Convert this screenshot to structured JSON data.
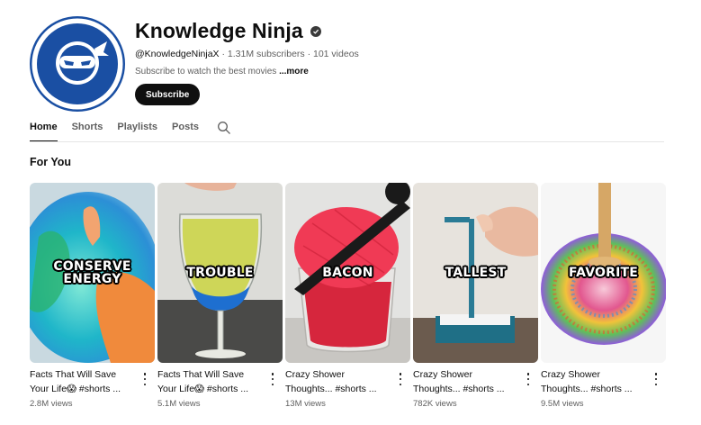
{
  "channel": {
    "name": "Knowledge Ninja",
    "handle": "@KnowledgeNinjaX",
    "stats": " · 1.31M subscribers · 101 videos",
    "description": "Subscribe to watch the best movies ",
    "more_label": "...more",
    "subscribe_label": "Subscribe"
  },
  "tabs": [
    {
      "label": "Home",
      "active": true
    },
    {
      "label": "Shorts",
      "active": false
    },
    {
      "label": "Playlists",
      "active": false
    },
    {
      "label": "Posts",
      "active": false
    }
  ],
  "section_title": "For You",
  "shorts": [
    {
      "caption_line1": "CONSERVE",
      "caption_line2": "ENERGY",
      "title_line1": "Facts That Will Save",
      "title_line2": "Your Life😱 #shorts ...",
      "views": "2.8M views"
    },
    {
      "caption_line1": "TROUBLE",
      "caption_line2": "",
      "title_line1": "Facts That Will Save",
      "title_line2": "Your Life😱 #shorts ...",
      "views": "5.1M views"
    },
    {
      "caption_line1": "BACON",
      "caption_line2": "",
      "title_line1": "Crazy Shower",
      "title_line2": "Thoughts... #shorts ...",
      "views": "13M views"
    },
    {
      "caption_line1": "TALLEST",
      "caption_line2": "",
      "title_line1": "Crazy Shower",
      "title_line2": "Thoughts... #shorts ...",
      "views": "782K views"
    },
    {
      "caption_line1": "FAVORITE",
      "caption_line2": "",
      "title_line1": "Crazy Shower",
      "title_line2": "Thoughts... #shorts ...",
      "views": "9.5M views"
    }
  ],
  "icons": {
    "verified": "verified-check-icon",
    "search": "search-icon",
    "more": "more-vertical-icon"
  },
  "colors": {
    "avatar_blue": "#1a4fa3",
    "subscribe_bg": "#0f0f0f",
    "muted_text": "#606060"
  }
}
